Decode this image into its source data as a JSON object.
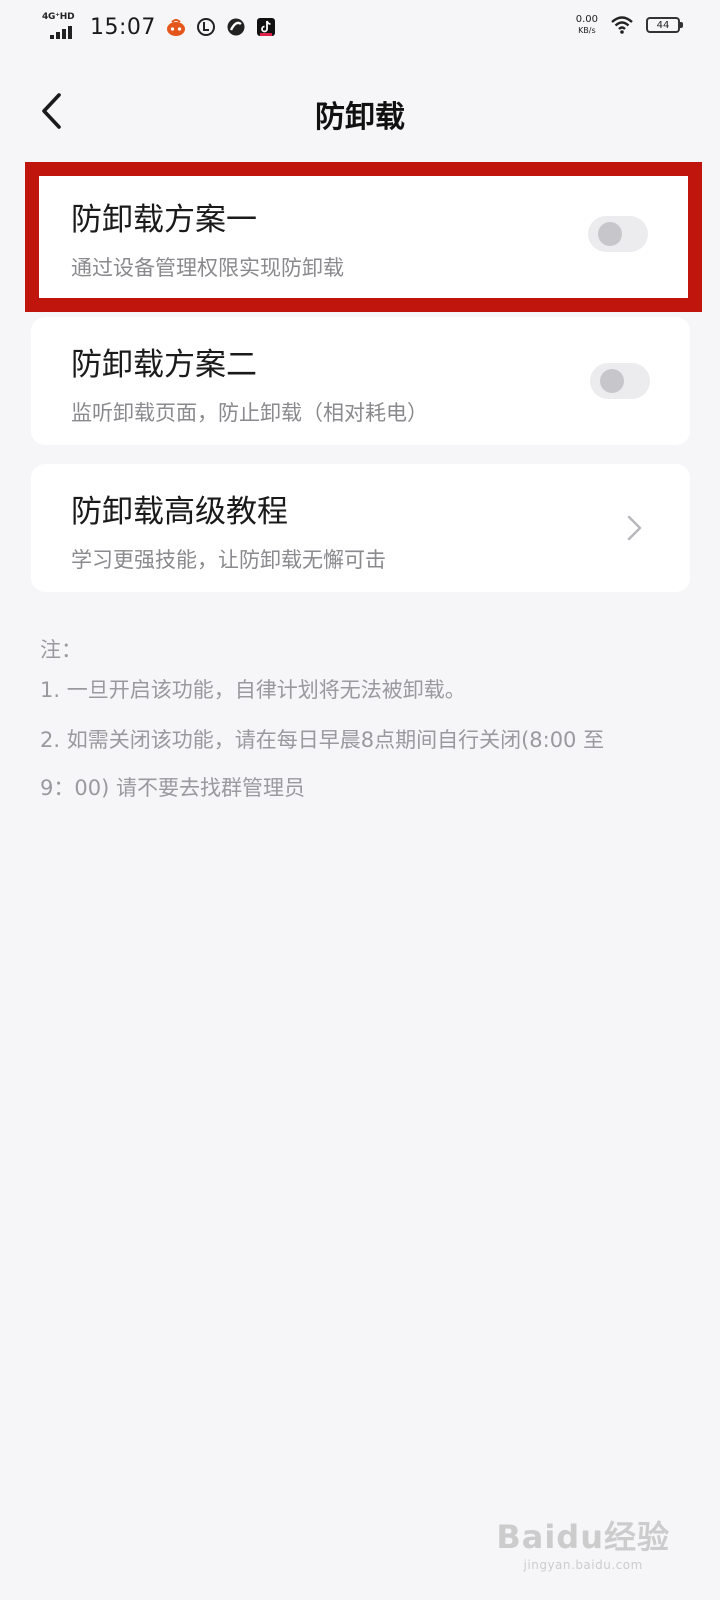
{
  "status_bar": {
    "network": "4G⁺HD",
    "time": "15:07",
    "net_speed": "0.00",
    "net_speed_unit": "KB/s",
    "battery": "44",
    "icons": [
      "taobao-icon",
      "app-circle-icon",
      "link-icon",
      "tiktok-icon",
      "wifi-icon",
      "battery-icon"
    ]
  },
  "header": {
    "title": "防卸载",
    "back_icon": "chevron-left-icon"
  },
  "options": [
    {
      "title": "防卸载方案一",
      "subtitle": "通过设备管理权限实现防卸载",
      "control": "toggle",
      "enabled": false,
      "highlighted": true
    },
    {
      "title": "防卸载方案二",
      "subtitle": "监听卸载页面，防止卸载（相对耗电）",
      "control": "toggle",
      "enabled": false
    },
    {
      "title": "防卸载高级教程",
      "subtitle": "学习更强技能，让防卸载无懈可击",
      "control": "chevron-right-icon"
    }
  ],
  "notes": {
    "heading": "注：",
    "lines": [
      "1. 一旦开启该功能，自律计划将无法被卸载。",
      "2. 如需关闭该功能，请在每日早晨8点期间自行关闭(8:00 至",
      "9：00) 请不要去找群管理员"
    ]
  },
  "watermark": {
    "main": "Baidu经验",
    "sub": "jingyan.baidu.com"
  },
  "colors": {
    "background": "#f6f6f8",
    "card": "#ffffff",
    "highlight_border": "#c0150c",
    "subtitle_text": "#8a8a8e",
    "toggle_track": "#ececee",
    "toggle_knob": "#c7c7cb"
  }
}
